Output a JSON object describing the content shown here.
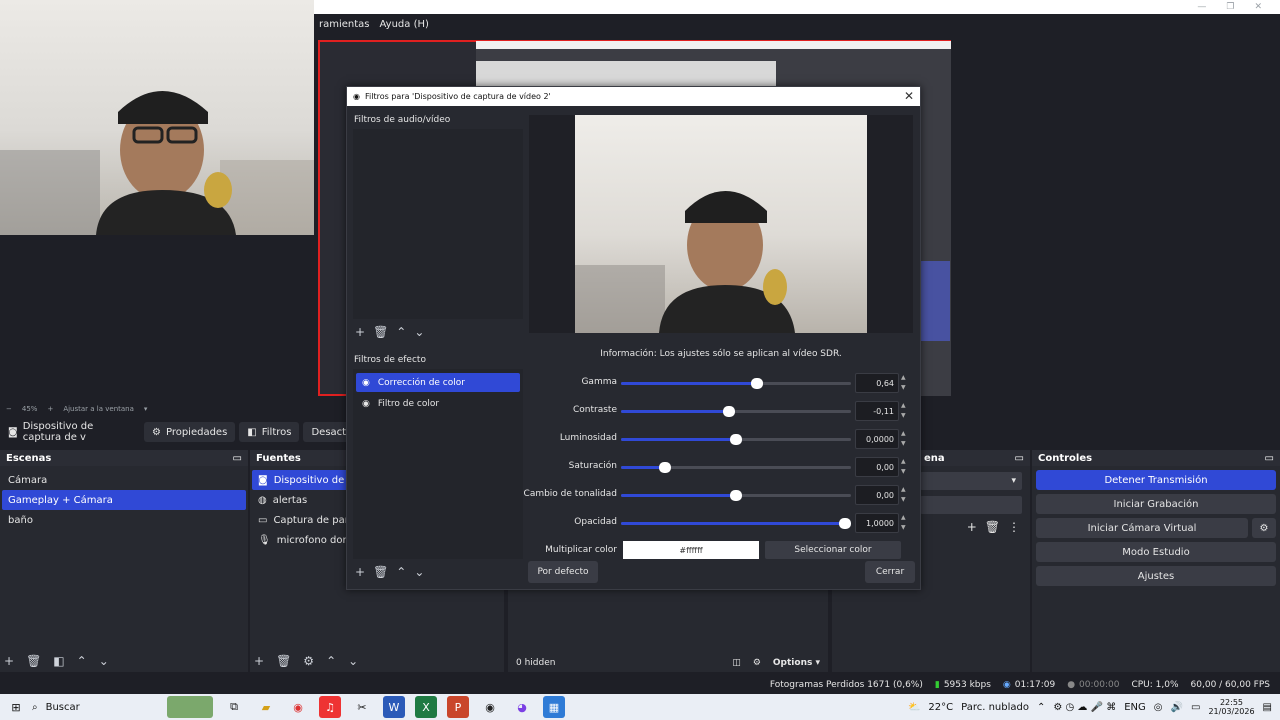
{
  "menubar": {
    "items": [
      "ramientas",
      "Ayuda (H)"
    ]
  },
  "window_controls": [
    "—",
    "❐",
    "✕"
  ],
  "preview": {
    "zoom": "45%",
    "fit_label": "Ajustar a la ventana"
  },
  "source_toolbar": {
    "source_name": "Dispositivo de captura de v",
    "properties": "Propiedades",
    "filters": "Filtros",
    "deactivate": "Desactivar"
  },
  "scenes": {
    "title": "Escenas",
    "items": [
      "Cámara",
      "Gameplay + Cámara",
      "baño"
    ],
    "selected_index": 1
  },
  "sources": {
    "title": "Fuentes",
    "items": [
      {
        "label": "Dispositivo de capt",
        "icon": "camera-icon"
      },
      {
        "label": "alertas",
        "icon": "globe-icon"
      },
      {
        "label": "Captura de pantall",
        "icon": "monitor-icon"
      },
      {
        "label": "microfono dorado",
        "icon": "mic-icon"
      }
    ]
  },
  "mixer": {
    "hidden_count": "0 hidden",
    "options": "Options"
  },
  "transitions": {
    "title": "ena"
  },
  "controls": {
    "title": "Controles",
    "buttons": [
      {
        "label": "Detener Transmisión",
        "active": true
      },
      {
        "label": "Iniciar Grabación",
        "active": false
      },
      {
        "label": "Iniciar Cámara Virtual",
        "active": false
      },
      {
        "label": "Modo Estudio",
        "active": false
      },
      {
        "label": "Ajustes",
        "active": false
      }
    ]
  },
  "status": {
    "dropped_frames": "Fotogramas Perdidos 1671 (0,6%)",
    "bitrate": "5953 kbps",
    "stream_time": "01:17:09",
    "rec_time": "00:00:00",
    "cpu": "CPU: 1,0%",
    "fps": "60,00 / 60,00 FPS"
  },
  "taskbar": {
    "search": "Buscar",
    "weather_temp": "22°C",
    "weather_desc": "Parc. nublado",
    "lang": "ENG",
    "time": "22:55",
    "date": "21/03/2026"
  },
  "dialog": {
    "title": "Filtros para 'Dispositivo de captura de vídeo 2'",
    "av_filters_label": "Filtros de audio/vídeo",
    "effect_filters_label": "Filtros de efecto",
    "effect_filters": [
      {
        "label": "Corrección de color",
        "selected": true
      },
      {
        "label": "Filtro de color",
        "selected": false
      }
    ],
    "info": "Información: Los ajustes sólo se aplican al vídeo SDR.",
    "properties": [
      {
        "label": "Gamma",
        "value": "0,64",
        "level": 0.59
      },
      {
        "label": "Contraste",
        "value": "-0,11",
        "level": 0.47
      },
      {
        "label": "Luminosidad",
        "value": "0,0000",
        "level": 0.5
      },
      {
        "label": "Saturación",
        "value": "0,00",
        "level": 0.19
      },
      {
        "label": "Cambio de tonalidad",
        "value": "0,00",
        "level": 0.5
      },
      {
        "label": "Opacidad",
        "value": "1,0000",
        "level": 1.0
      }
    ],
    "multiply_color_label": "Multiplicar color",
    "multiply_color_value": "#ffffff",
    "select_color": "Seleccionar color",
    "defaults": "Por defecto",
    "close": "Cerrar"
  },
  "colors": {
    "accent": "#3049d6",
    "selection_border": "#e02020",
    "background": "#1e1f26"
  }
}
